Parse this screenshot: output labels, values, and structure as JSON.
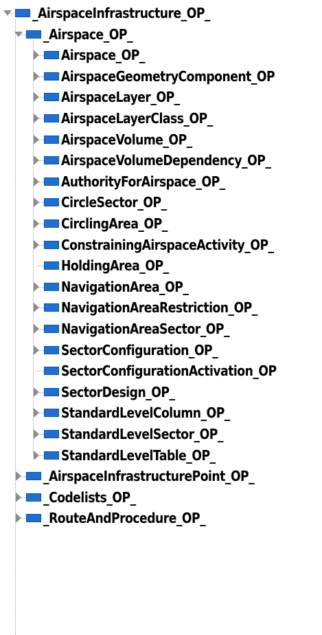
{
  "tree": {
    "root": {
      "label": "_AirspaceInfrastructure_OP_",
      "expanded": true,
      "children": [
        {
          "label": "_Airspace_OP_",
          "expanded": true,
          "children": [
            {
              "label": "Airspace_OP_",
              "expandable": true
            },
            {
              "label": "AirspaceGeometryComponent_OP",
              "expandable": true
            },
            {
              "label": "AirspaceLayer_OP_",
              "expandable": true
            },
            {
              "label": "AirspaceLayerClass_OP_",
              "expandable": true
            },
            {
              "label": "AirspaceVolume_OP_",
              "expandable": true
            },
            {
              "label": "AirspaceVolumeDependency_OP_",
              "expandable": true
            },
            {
              "label": "AuthorityForAirspace_OP_",
              "expandable": true
            },
            {
              "label": "CircleSector_OP_",
              "expandable": true
            },
            {
              "label": "CirclingArea_OP_",
              "expandable": true
            },
            {
              "label": "ConstrainingAirspaceActivity_OP_",
              "expandable": true
            },
            {
              "label": "HoldingArea_OP_",
              "expandable": false
            },
            {
              "label": "NavigationArea_OP_",
              "expandable": true
            },
            {
              "label": "NavigationAreaRestriction_OP_",
              "expandable": true
            },
            {
              "label": "NavigationAreaSector_OP_",
              "expandable": true
            },
            {
              "label": "SectorConfiguration_OP_",
              "expandable": true
            },
            {
              "label": "SectorConfigurationActivation_OP",
              "expandable": false
            },
            {
              "label": "SectorDesign_OP_",
              "expandable": true
            },
            {
              "label": "StandardLevelColumn_OP_",
              "expandable": true
            },
            {
              "label": "StandardLevelSector_OP_",
              "expandable": true
            },
            {
              "label": "StandardLevelTable_OP_",
              "expandable": true
            }
          ]
        },
        {
          "label": "_AirspaceInfrastructurePoint_OP_",
          "expanded": false,
          "expandable": true
        },
        {
          "label": "_Codelists_OP_",
          "expanded": false,
          "expandable": true
        },
        {
          "label": "_RouteAndProcedure_OP_",
          "expanded": false,
          "expandable": true
        }
      ]
    },
    "colors": {
      "folder_fill": "#1f6fd1",
      "connector": "#9a9a9a",
      "text": "#000000"
    },
    "icons": {
      "expanded": "triangle-down-icon",
      "collapsed": "triangle-right-icon",
      "node": "folder-icon"
    }
  }
}
